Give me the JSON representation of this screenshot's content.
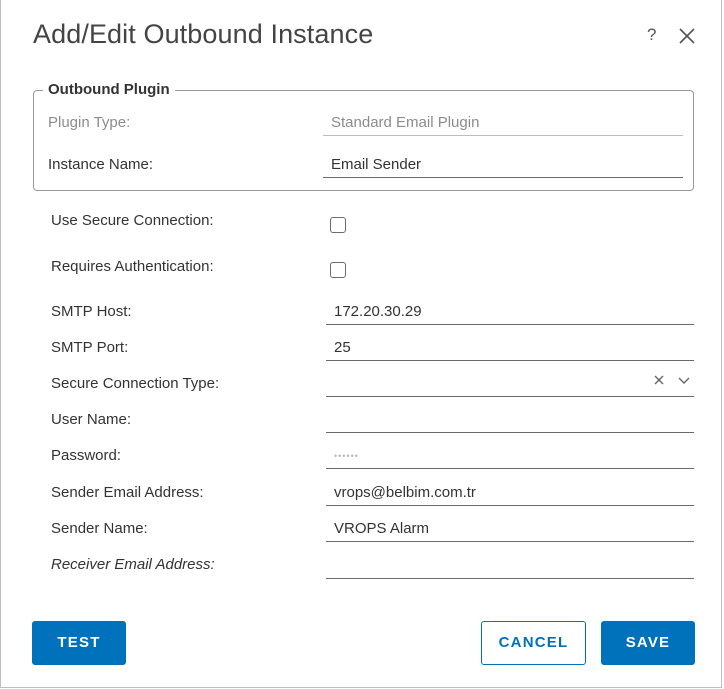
{
  "dialog": {
    "title": "Add/Edit Outbound Instance",
    "help": "?",
    "close_icon": "close-icon"
  },
  "plugin_section": {
    "legend": "Outbound Plugin",
    "plugin_type_label": "Plugin Type:",
    "plugin_type_value": "Standard Email Plugin",
    "instance_name_label": "Instance Name:",
    "instance_name_value": "Email Sender"
  },
  "form": {
    "use_secure_connection_label": "Use Secure Connection:",
    "use_secure_connection_checked": false,
    "requires_authentication_label": "Requires Authentication:",
    "requires_authentication_checked": false,
    "smtp_host_label": "SMTP Host:",
    "smtp_host_value": "172.20.30.29",
    "smtp_port_label": "SMTP Port:",
    "smtp_port_value": "25",
    "secure_connection_type_label": "Secure Connection Type:",
    "secure_connection_type_value": "",
    "user_name_label": "User Name:",
    "user_name_value": "",
    "password_label": "Password:",
    "password_value": "••••••",
    "sender_email_label": "Sender Email Address:",
    "sender_email_value": "vrops@belbim.com.tr",
    "sender_name_label": "Sender Name:",
    "sender_name_value": "VROPS Alarm",
    "receiver_email_label": "Receiver Email Address:",
    "receiver_email_value": ""
  },
  "buttons": {
    "test": "TEST",
    "cancel": "CANCEL",
    "save": "SAVE"
  },
  "colors": {
    "accent": "#0072bb",
    "text": "#333333",
    "muted": "#8c8c8c"
  }
}
